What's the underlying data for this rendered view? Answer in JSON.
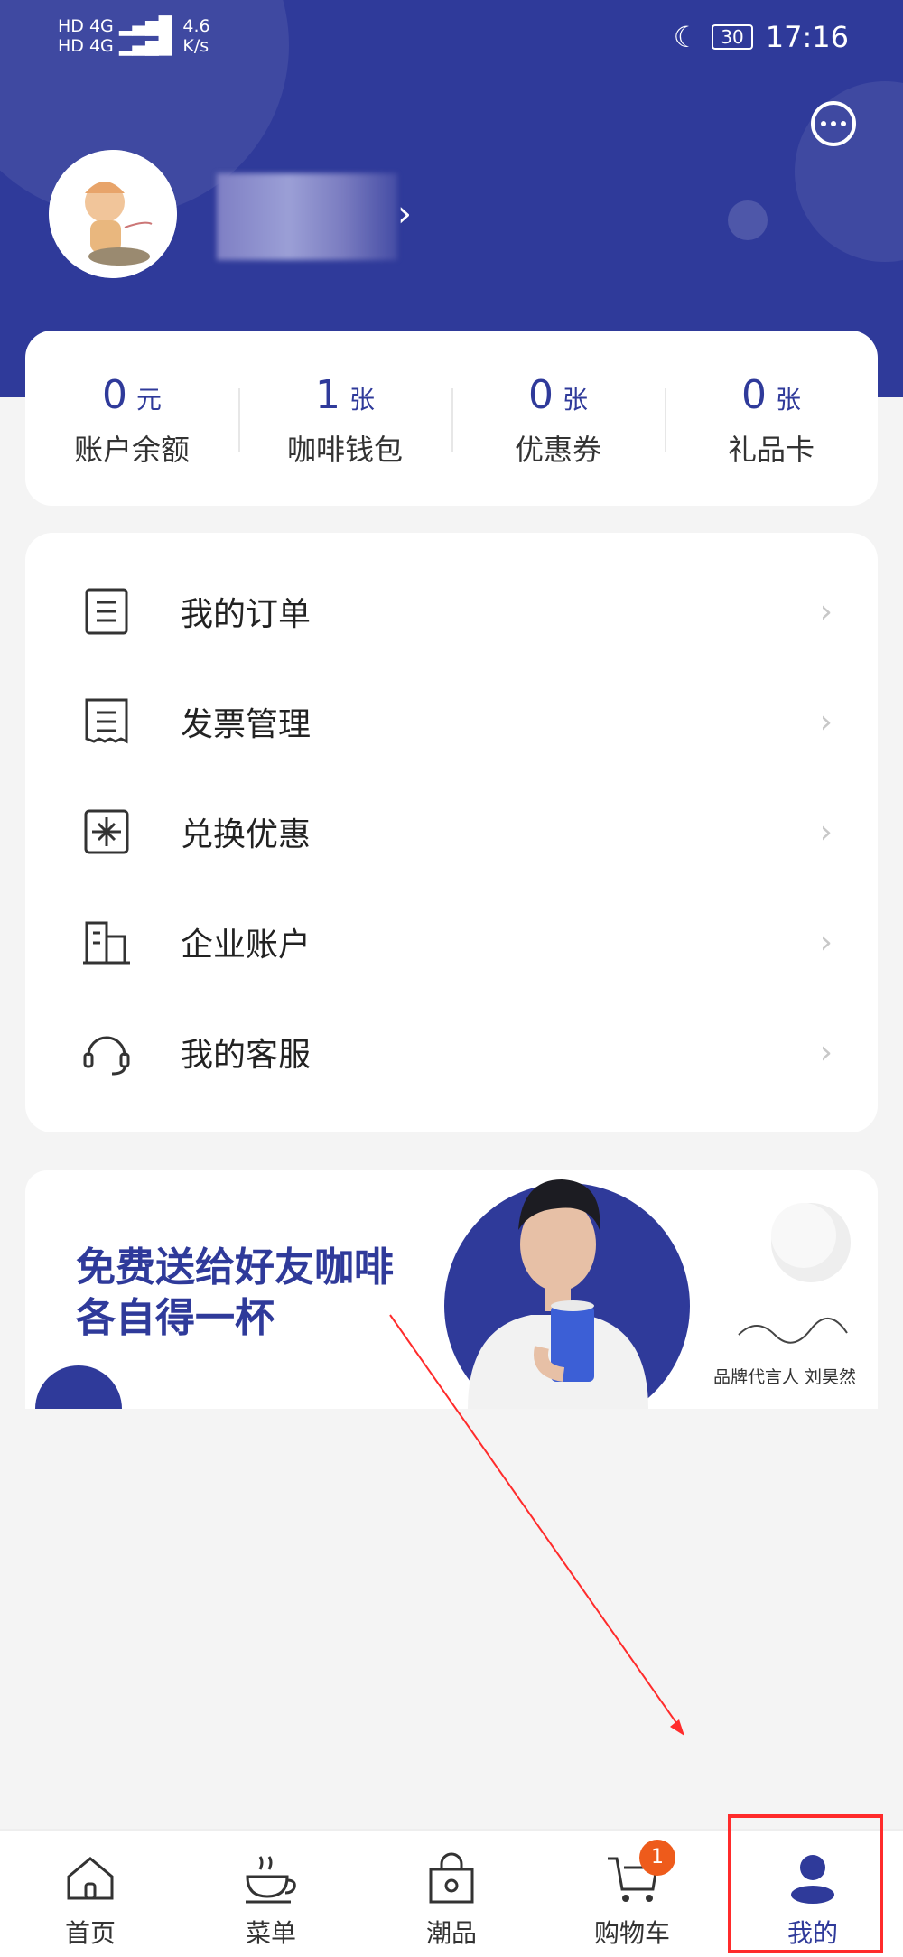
{
  "status_bar": {
    "left_text_1": "HD 4G",
    "left_text_2": "HD 4G",
    "speed": "4.6",
    "speed_unit": "K/s",
    "battery": "30",
    "time": "17:16"
  },
  "profile": {
    "avatar_icon": "avatar-image",
    "message_icon": "chat-bubble-icon"
  },
  "stats": [
    {
      "value": "0",
      "unit": "元",
      "label": "账户余额"
    },
    {
      "value": "1",
      "unit": "张",
      "label": "咖啡钱包"
    },
    {
      "value": "0",
      "unit": "张",
      "label": "优惠券"
    },
    {
      "value": "0",
      "unit": "张",
      "label": "礼品卡"
    }
  ],
  "menu": [
    {
      "label": "我的订单",
      "icon": "order-list-icon"
    },
    {
      "label": "发票管理",
      "icon": "invoice-icon"
    },
    {
      "label": "兑换优惠",
      "icon": "gift-box-icon"
    },
    {
      "label": "企业账户",
      "icon": "building-icon"
    },
    {
      "label": "我的客服",
      "icon": "headset-icon"
    }
  ],
  "banner": {
    "line1": "免费送给好友咖啡",
    "line2": "各自得一杯",
    "signature": "品牌代言人 刘昊然"
  },
  "tabs": [
    {
      "label": "首页",
      "icon": "home-icon"
    },
    {
      "label": "菜单",
      "icon": "coffee-cup-icon"
    },
    {
      "label": "潮品",
      "icon": "shopping-bag-icon"
    },
    {
      "label": "购物车",
      "icon": "cart-icon",
      "badge": "1"
    },
    {
      "label": "我的",
      "icon": "user-icon",
      "active": true
    }
  ],
  "colors": {
    "brand": "#2f3a9a",
    "badge": "#ee5b1b",
    "annotation": "#ff2b2b"
  }
}
